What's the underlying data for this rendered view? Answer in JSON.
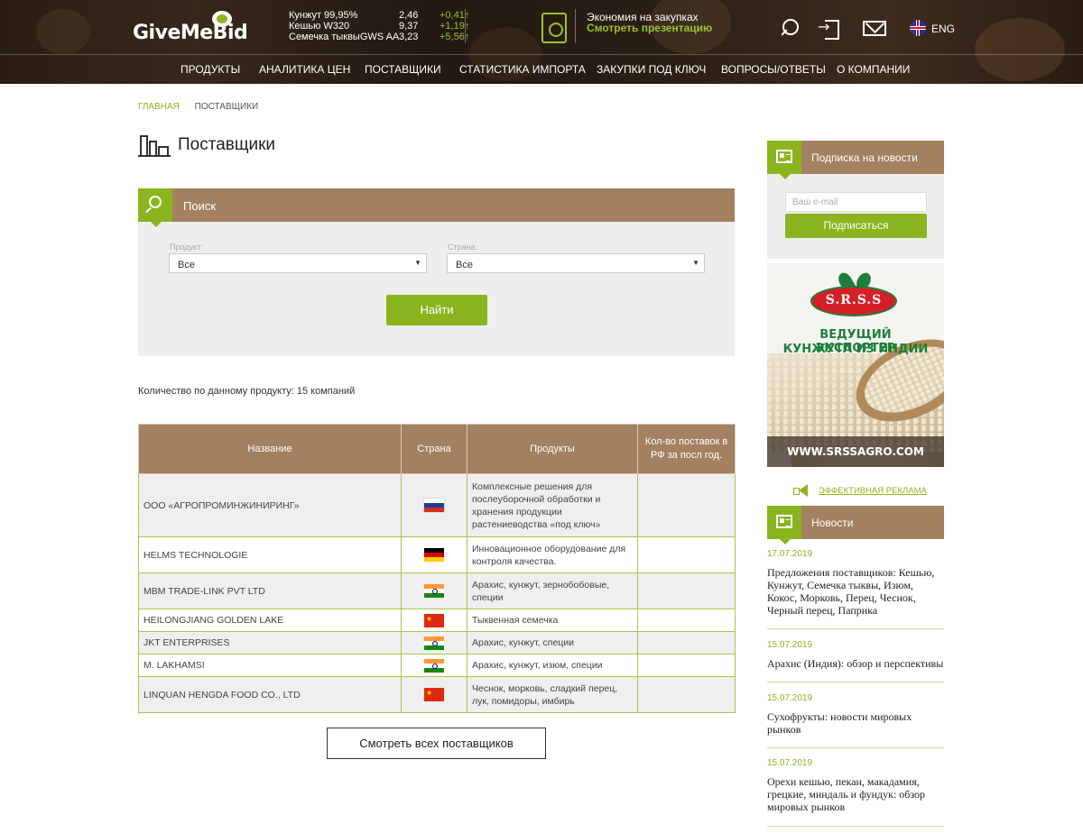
{
  "header": {
    "logo_text": "GiveMeBid",
    "ticker": [
      {
        "name": "Кунжут 99,95%",
        "value": "2,46",
        "change": "+0,41↑"
      },
      {
        "name": "Кешью W320",
        "value": "9,37",
        "change": "+1,19↑"
      },
      {
        "name": "Семечка тыквыGWS AA",
        "value": "3,23",
        "change": "+5,56↑"
      }
    ],
    "promo_line1": "Экономия на закупках",
    "promo_line2": "Смотреть презентацию",
    "lang_label": "ENG",
    "icons": {
      "search": "search-icon",
      "login": "login-icon",
      "mail": "mail-icon",
      "flag": "uk-flag-icon"
    }
  },
  "nav": [
    "ПРОДУКТЫ",
    "АНАЛИТИКА ЦЕН",
    "ПОСТАВЩИКИ",
    "СТАТИСТИКА ИМПОРТА",
    "ЗАКУПКИ ПОД КЛЮЧ",
    "ВОПРОСЫ/ОТВЕТЫ",
    "О КОМПАНИИ"
  ],
  "breadcrumb": [
    "ГЛАВНАЯ",
    "ПОСТАВЩИКИ"
  ],
  "page_title": "Поставщики",
  "search": {
    "title": "Поиск",
    "product_label": "Продукт:",
    "product_value": "Все",
    "country_label": "Страна:",
    "country_value": "Все",
    "find_button": "Найти"
  },
  "count_text": "Количество по данному продукту: 15 компаний",
  "table": {
    "headers": [
      "Название",
      "Страна",
      "Продукты",
      "Кол-во поставок в РФ за посл год."
    ],
    "rows": [
      {
        "name": "ООО «АГРОПРОМИНЖИНИРИНГ»",
        "country_flag": "ru",
        "products": "Комплексные решения для послеуборочной обработки и хранения продукции растениеводства «под ключ»",
        "deliveries": ""
      },
      {
        "name": "HELMS TECHNOLOGIE",
        "country_flag": "de",
        "products": "Инновационное оборудование для контроля качества.",
        "deliveries": ""
      },
      {
        "name": "MBM TRADE-LINK PVT LTD",
        "country_flag": "in",
        "products": "Арахис, кунжут, зернобобовые, специи",
        "deliveries": ""
      },
      {
        "name": "HEILONGJIANG GOLDEN LAKE",
        "country_flag": "cn",
        "products": "Тыквенная семечка",
        "deliveries": ""
      },
      {
        "name": "JKT ENTERPRISES",
        "country_flag": "in",
        "products": "Арахис, кунжут, специи",
        "deliveries": ""
      },
      {
        "name": "M. LAKHAMSI",
        "country_flag": "in",
        "products": "Арахис, кунжут, изюм, специи",
        "deliveries": ""
      },
      {
        "name": "LINQUAN HENGDA FOOD CO., LTD",
        "country_flag": "cn",
        "products": "Чеснок, морковь, сладкий перец, лук, помидоры, имбирь",
        "deliveries": ""
      }
    ]
  },
  "view_all_button": "Смотреть всех поставщиков",
  "sidebar": {
    "subscribe_title": "Подписка на новости",
    "email_placeholder": "Ваш e-mail",
    "subscribe_button": "Подписаться",
    "ad": {
      "brand": "S.R.S.S",
      "line1": "ВЕДУЩИЙ ЭКСПОРТЕР",
      "line2": "КУНЖУТА ИЗ ИНДИИ",
      "url": "WWW.SRSSAGRO.COM"
    },
    "ad_link": "ЭФФЕКТИВНАЯ РЕКЛАМА",
    "news_title": "Новости",
    "news": [
      {
        "date": "17.07.2019",
        "text": "Предложения поставщиков: Кешью, Кунжут, Семечка тыквы, Изюм, Кокос, Морковь, Перец, Чеснок, Черный перец, Паприка"
      },
      {
        "date": "15.07.2019",
        "text": "Арахис (Индия): обзор и перспективы"
      },
      {
        "date": "15.07.2019",
        "text": "Сухофрукты: новости мировых рынков"
      },
      {
        "date": "15.07.2019",
        "text": "Орехи кешью, пекан, макадамия, грецкие, миндаль и фундук: обзор мировых рынков"
      }
    ]
  },
  "colors": {
    "accent_green": "#8ab51e",
    "brown": "#a3805f",
    "panel_gray": "#eeeeee"
  }
}
